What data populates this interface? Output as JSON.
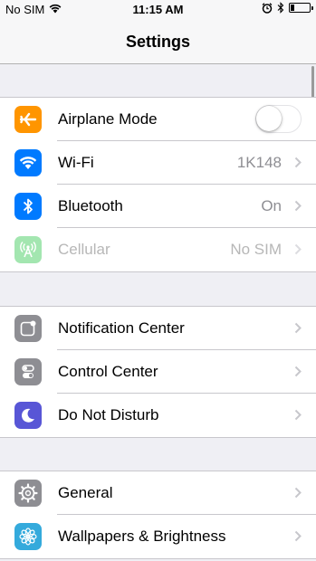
{
  "status_bar": {
    "carrier": "No SIM",
    "time": "11:15 AM",
    "icons": [
      "wifi-icon",
      "alarm-icon",
      "bluetooth-icon",
      "battery-icon"
    ]
  },
  "nav": {
    "title": "Settings"
  },
  "groups": [
    [
      {
        "label": "Airplane Mode",
        "icon": "airplane-icon",
        "color": "#ff9500",
        "toggle": false
      },
      {
        "label": "Wi-Fi",
        "icon": "wifi-icon",
        "color": "#007aff",
        "value": "1K148"
      },
      {
        "label": "Bluetooth",
        "icon": "bluetooth-icon",
        "color": "#007aff",
        "value": "On"
      },
      {
        "label": "Cellular",
        "icon": "cellular-icon",
        "color": "#a3e6b0",
        "value": "No SIM",
        "disabled": true
      }
    ],
    [
      {
        "label": "Notification Center",
        "icon": "notification-center-icon",
        "color": "#8e8e93"
      },
      {
        "label": "Control Center",
        "icon": "control-center-icon",
        "color": "#8e8e93"
      },
      {
        "label": "Do Not Disturb",
        "icon": "moon-icon",
        "color": "#5856d6"
      }
    ],
    [
      {
        "label": "General",
        "icon": "gear-icon",
        "color": "#8e8e93"
      },
      {
        "label": "Wallpapers & Brightness",
        "icon": "flower-icon",
        "color": "#34aadc"
      }
    ]
  ]
}
